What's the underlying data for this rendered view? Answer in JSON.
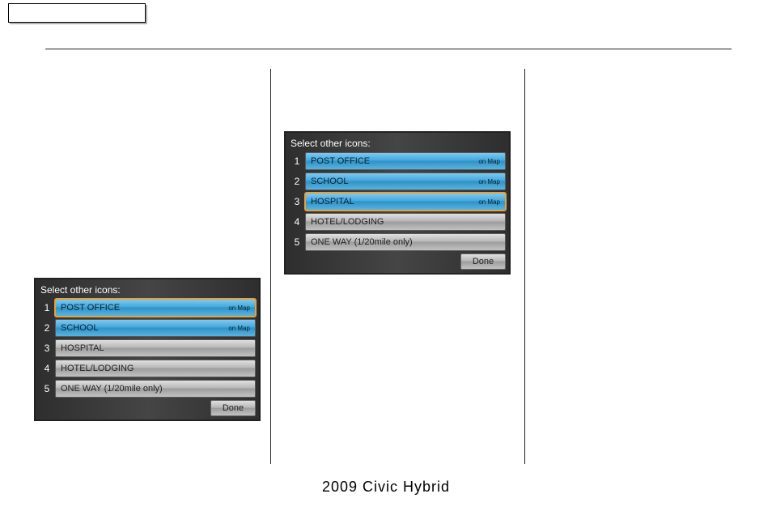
{
  "footer": "2009  Civic  Hybrid",
  "screenA": {
    "title": "Select other icons:",
    "rows": [
      {
        "num": "1",
        "label": "POST OFFICE",
        "onMap": "on Map",
        "selected": true,
        "highlighted": true
      },
      {
        "num": "2",
        "label": "SCHOOL",
        "onMap": "on Map",
        "selected": true,
        "highlighted": false
      },
      {
        "num": "3",
        "label": "HOSPITAL",
        "onMap": "",
        "selected": false,
        "highlighted": false
      },
      {
        "num": "4",
        "label": "HOTEL/LODGING",
        "onMap": "",
        "selected": false,
        "highlighted": false
      },
      {
        "num": "5",
        "label": "ONE WAY (1/20mile only)",
        "onMap": "",
        "selected": false,
        "highlighted": false
      }
    ],
    "done": "Done"
  },
  "screenB": {
    "title": "Select other icons:",
    "rows": [
      {
        "num": "1",
        "label": "POST OFFICE",
        "onMap": "on Map",
        "selected": true,
        "highlighted": false
      },
      {
        "num": "2",
        "label": "SCHOOL",
        "onMap": "on Map",
        "selected": true,
        "highlighted": false
      },
      {
        "num": "3",
        "label": "HOSPITAL",
        "onMap": "on Map",
        "selected": true,
        "highlighted": true
      },
      {
        "num": "4",
        "label": "HOTEL/LODGING",
        "onMap": "",
        "selected": false,
        "highlighted": false
      },
      {
        "num": "5",
        "label": "ONE WAY (1/20mile only)",
        "onMap": "",
        "selected": false,
        "highlighted": false
      }
    ],
    "done": "Done"
  }
}
